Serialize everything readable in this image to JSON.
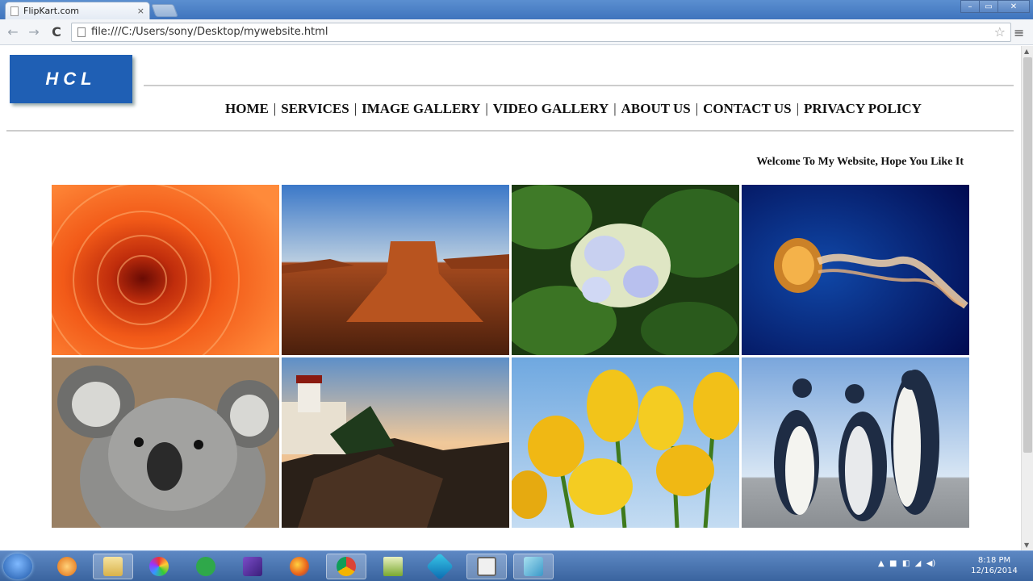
{
  "browser": {
    "tab_title": "FlipKart.com",
    "tab_close": "×",
    "address": "file:///C:/Users/sony/Desktop/mywebsite.html",
    "back": "←",
    "forward": "→",
    "reload": "C",
    "star": "☆",
    "menu": "≡",
    "window_controls": {
      "minimize": "–",
      "maximize": "▭",
      "close": "✕"
    }
  },
  "site": {
    "logo_text": "HCL",
    "nav": [
      {
        "label": "HOME"
      },
      {
        "label": "SERVICES"
      },
      {
        "label": "IMAGE GALLERY"
      },
      {
        "label": "VIDEO GALLERY"
      },
      {
        "label": "ABOUT US"
      },
      {
        "label": "CONTACT US"
      },
      {
        "label": "PRIVACY POLICY"
      }
    ],
    "nav_separator": "|",
    "welcome": "Welcome To My Website, Hope You Like It",
    "gallery": [
      {
        "name": "chrysanthemum"
      },
      {
        "name": "desert"
      },
      {
        "name": "hydrangeas"
      },
      {
        "name": "jellyfish"
      },
      {
        "name": "koala"
      },
      {
        "name": "lighthouse"
      },
      {
        "name": "tulips"
      },
      {
        "name": "penguins"
      }
    ]
  },
  "taskbar": {
    "clock_time": "8:18 PM",
    "clock_date": "12/16/2014",
    "apps": [
      "start-orb",
      "media-player",
      "file-explorer",
      "picasa",
      "evernote",
      "visual-studio",
      "firefox",
      "chrome",
      "notepad-app",
      "app-store",
      "window-app",
      "screen-capture"
    ]
  },
  "colors": {
    "logo_blue": "#1f5fb4",
    "taskbar": "#3a649f",
    "titlebar": "#4a7fc4"
  }
}
